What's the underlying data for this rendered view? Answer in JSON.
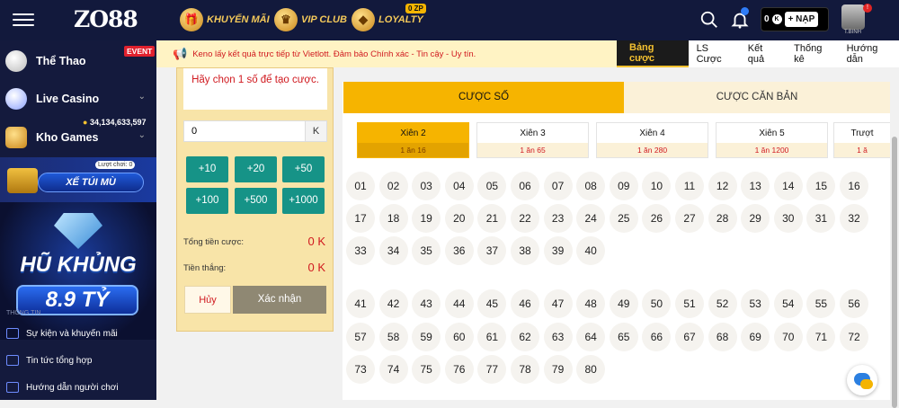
{
  "header": {
    "logo": "ZO88",
    "promos": [
      {
        "label": "KHUYẾN MÃI",
        "icon": "gift-icon"
      },
      {
        "label": "VIP CLUB",
        "icon": "crown-icon"
      },
      {
        "label": "LOYALTY",
        "icon": "diamond-icon",
        "badge": "0 ZP"
      }
    ],
    "balance": "0",
    "balance_unit": "K",
    "deposit_label": "+ NẠP",
    "notification_count": "1",
    "avatar_label": "T.BINH"
  },
  "sidebar": {
    "items": [
      {
        "label": "Thể Thao",
        "badge": "EVENT"
      },
      {
        "label": "Live Casino"
      },
      {
        "label": "Kho Games"
      }
    ],
    "jackpot_amount": "34,134,633,597",
    "xe_tui_mu": {
      "label": "XẾ TÚI MÙ",
      "tag": "Lượt chơi: 0"
    },
    "hu_khung": {
      "title": "HŨ KHỦNG",
      "amount": "8.9 TỶ"
    },
    "section_title": "THÔNG TIN",
    "links": [
      "Sự kiện và khuyến mãi",
      "Tin tức tổng hợp",
      "Hướng dẫn người chơi"
    ]
  },
  "marquee": {
    "text": "Keno lấy kết quả trực tiếp từ Vietlott. Đảm bảo Chính xác - Tin cậy - Uy tín."
  },
  "main_tabs": [
    {
      "label": "Bảng cược",
      "active": true
    },
    {
      "label": "LS Cược",
      "active": false
    },
    {
      "label": "Kết quả",
      "active": false
    },
    {
      "label": "Thống kê",
      "active": false
    },
    {
      "label": "Hướng dẫn",
      "active": false
    }
  ],
  "bet_panel": {
    "hint": "Hãy chọn 1 số để tạo cược.",
    "amount_value": "0",
    "amount_unit": "K",
    "chips": [
      "+10",
      "+20",
      "+50",
      "+100",
      "+500",
      "+1000"
    ],
    "total_label": "Tổng tiền cược:",
    "total_value": "0 K",
    "win_label": "Tiền thắng:",
    "win_value": "0 K",
    "cancel_label": "Hủy",
    "confirm_label": "Xác nhận"
  },
  "bet_tabs": [
    {
      "label": "CƯỢC SỐ",
      "active": true
    },
    {
      "label": "CƯỢC CĂN BẢN",
      "active": false
    }
  ],
  "xien_options": [
    {
      "name": "Xiên 2",
      "rate": "1 ăn 16",
      "active": true
    },
    {
      "name": "Xiên 3",
      "rate": "1 ăn 65",
      "active": false
    },
    {
      "name": "Xiên 4",
      "rate": "1 ăn 280",
      "active": false
    },
    {
      "name": "Xiên 5",
      "rate": "1 ăn 1200",
      "active": false
    },
    {
      "name": "Trượt",
      "rate": "1 ă",
      "active": false
    }
  ],
  "numbers": [
    "01",
    "02",
    "03",
    "04",
    "05",
    "06",
    "07",
    "08",
    "09",
    "10",
    "11",
    "12",
    "13",
    "14",
    "15",
    "16",
    "17",
    "18",
    "19",
    "20",
    "21",
    "22",
    "23",
    "24",
    "25",
    "26",
    "27",
    "28",
    "29",
    "30",
    "31",
    "32",
    "33",
    "34",
    "35",
    "36",
    "37",
    "38",
    "39",
    "40",
    "41",
    "42",
    "43",
    "44",
    "45",
    "46",
    "47",
    "48",
    "49",
    "50",
    "51",
    "52",
    "53",
    "54",
    "55",
    "56",
    "57",
    "58",
    "59",
    "60",
    "61",
    "62",
    "63",
    "64",
    "65",
    "66",
    "67",
    "68",
    "69",
    "70",
    "71",
    "72",
    "73",
    "74",
    "75",
    "76",
    "77",
    "78",
    "79",
    "80"
  ]
}
